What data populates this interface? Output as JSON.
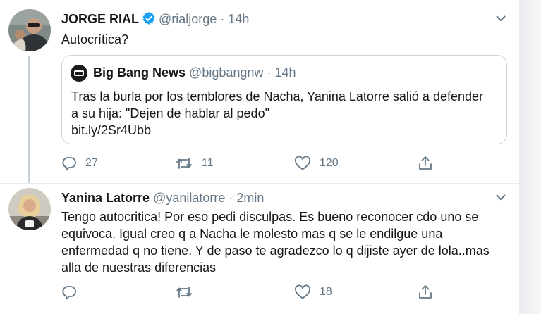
{
  "tweets": [
    {
      "name": "JORGE RIAL",
      "verified": true,
      "handle": "@rialjorge",
      "separator": "·",
      "time": "14h",
      "text": "Autocrítica?",
      "quote": {
        "name": "Big Bang News",
        "handle": "@bigbangnw",
        "separator": "·",
        "time": "14h",
        "text_lines": [
          "Tras la burla por los temblores de Nacha, Yanina Latorre salió a defender",
          "a su hija: \"Dejen de hablar al pedo\"",
          "bit.ly/2Sr4Ubb"
        ]
      },
      "actions": {
        "replies": "27",
        "retweets": "11",
        "likes": "120"
      }
    },
    {
      "name": "Yanina Latorre",
      "handle": "@yanilatorre",
      "separator": "·",
      "time": "2min",
      "text_lines": [
        "Tengo autocritica! Por eso pedi disculpas. Es bueno reconocer cdo uno se",
        "equivoca. Igual creo q a Nacha le molesto mas q se le endilgue una",
        "enfermedad q no tiene. Y de paso te agradezco lo q dijiste ayer de lola..mas",
        "alla de nuestras diferencias"
      ],
      "actions": {
        "replies": "",
        "retweets": "",
        "likes": "18"
      }
    }
  ],
  "icons": [
    "reply-icon",
    "retweet-icon",
    "like-icon",
    "share-icon",
    "chevron-down-icon",
    "verified-badge-icon"
  ],
  "colors": {
    "verified": "#1da1f2",
    "text": "#14171a",
    "secondary": "#657786",
    "border": "#ccd6dd"
  }
}
